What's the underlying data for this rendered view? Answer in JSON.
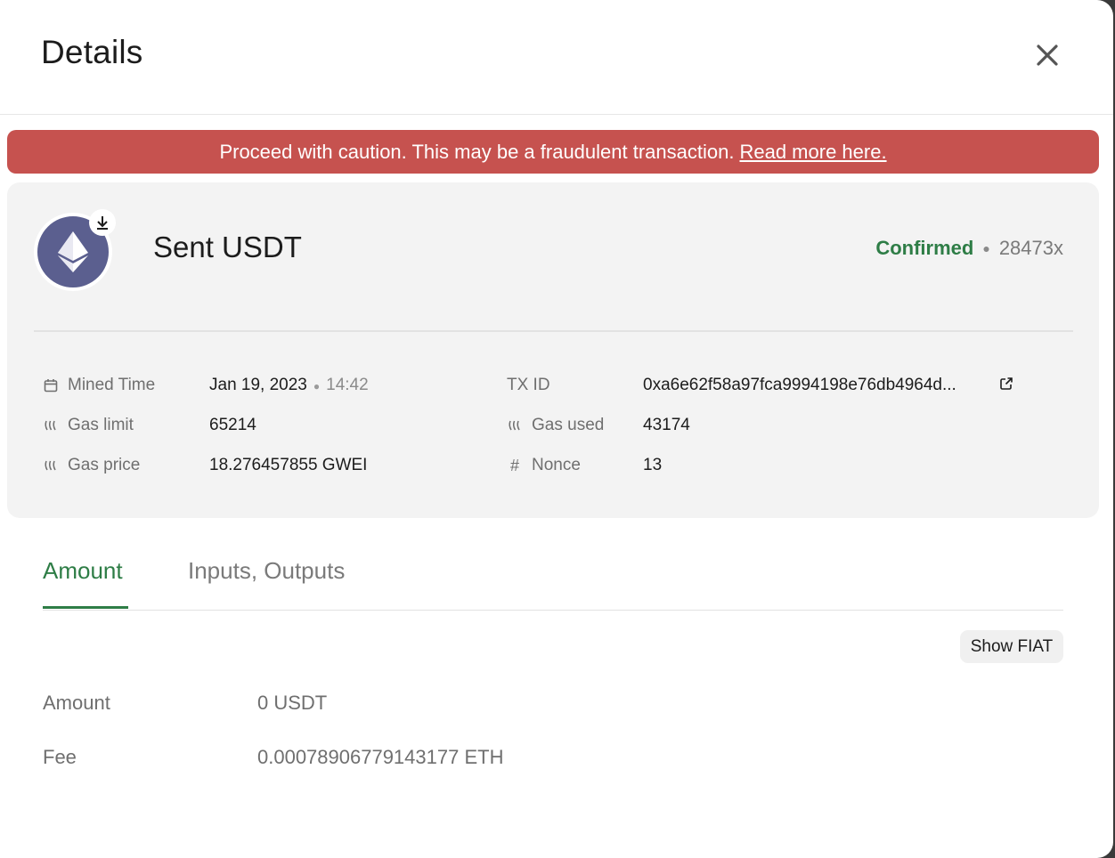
{
  "modal": {
    "title": "Details"
  },
  "warning": {
    "text": "Proceed with caution. This may be a fraudulent transaction.",
    "link": "Read more here."
  },
  "transaction": {
    "title": "Sent USDT",
    "status": "Confirmed",
    "confirmations": "28473x",
    "coin_icon": "ethereum-icon",
    "direction_icon": "download-icon"
  },
  "info": {
    "mined_time_label": "Mined Time",
    "mined_date": "Jan 19, 2023",
    "mined_time": "14:42",
    "gas_limit_label": "Gas limit",
    "gas_limit": "65214",
    "gas_price_label": "Gas price",
    "gas_price": "18.276457855 GWEI",
    "txid_label": "TX ID",
    "txid": "0xa6e62f58a97fca9994198e76db4964d...",
    "gas_used_label": "Gas used",
    "gas_used": "43174",
    "nonce_label": "Nonce",
    "nonce": "13"
  },
  "tabs": [
    {
      "label": "Amount",
      "active": true
    },
    {
      "label": "Inputs, Outputs",
      "active": false
    }
  ],
  "show_fiat_label": "Show FIAT",
  "amounts": {
    "amount_label": "Amount",
    "amount_value": "0 USDT",
    "fee_label": "Fee",
    "fee_value": "0.00078906779143177 ETH"
  },
  "colors": {
    "warning": "#c6524f",
    "confirmed": "#2e7d46",
    "coin": "#5b5f8f",
    "card": "#f3f3f3"
  }
}
